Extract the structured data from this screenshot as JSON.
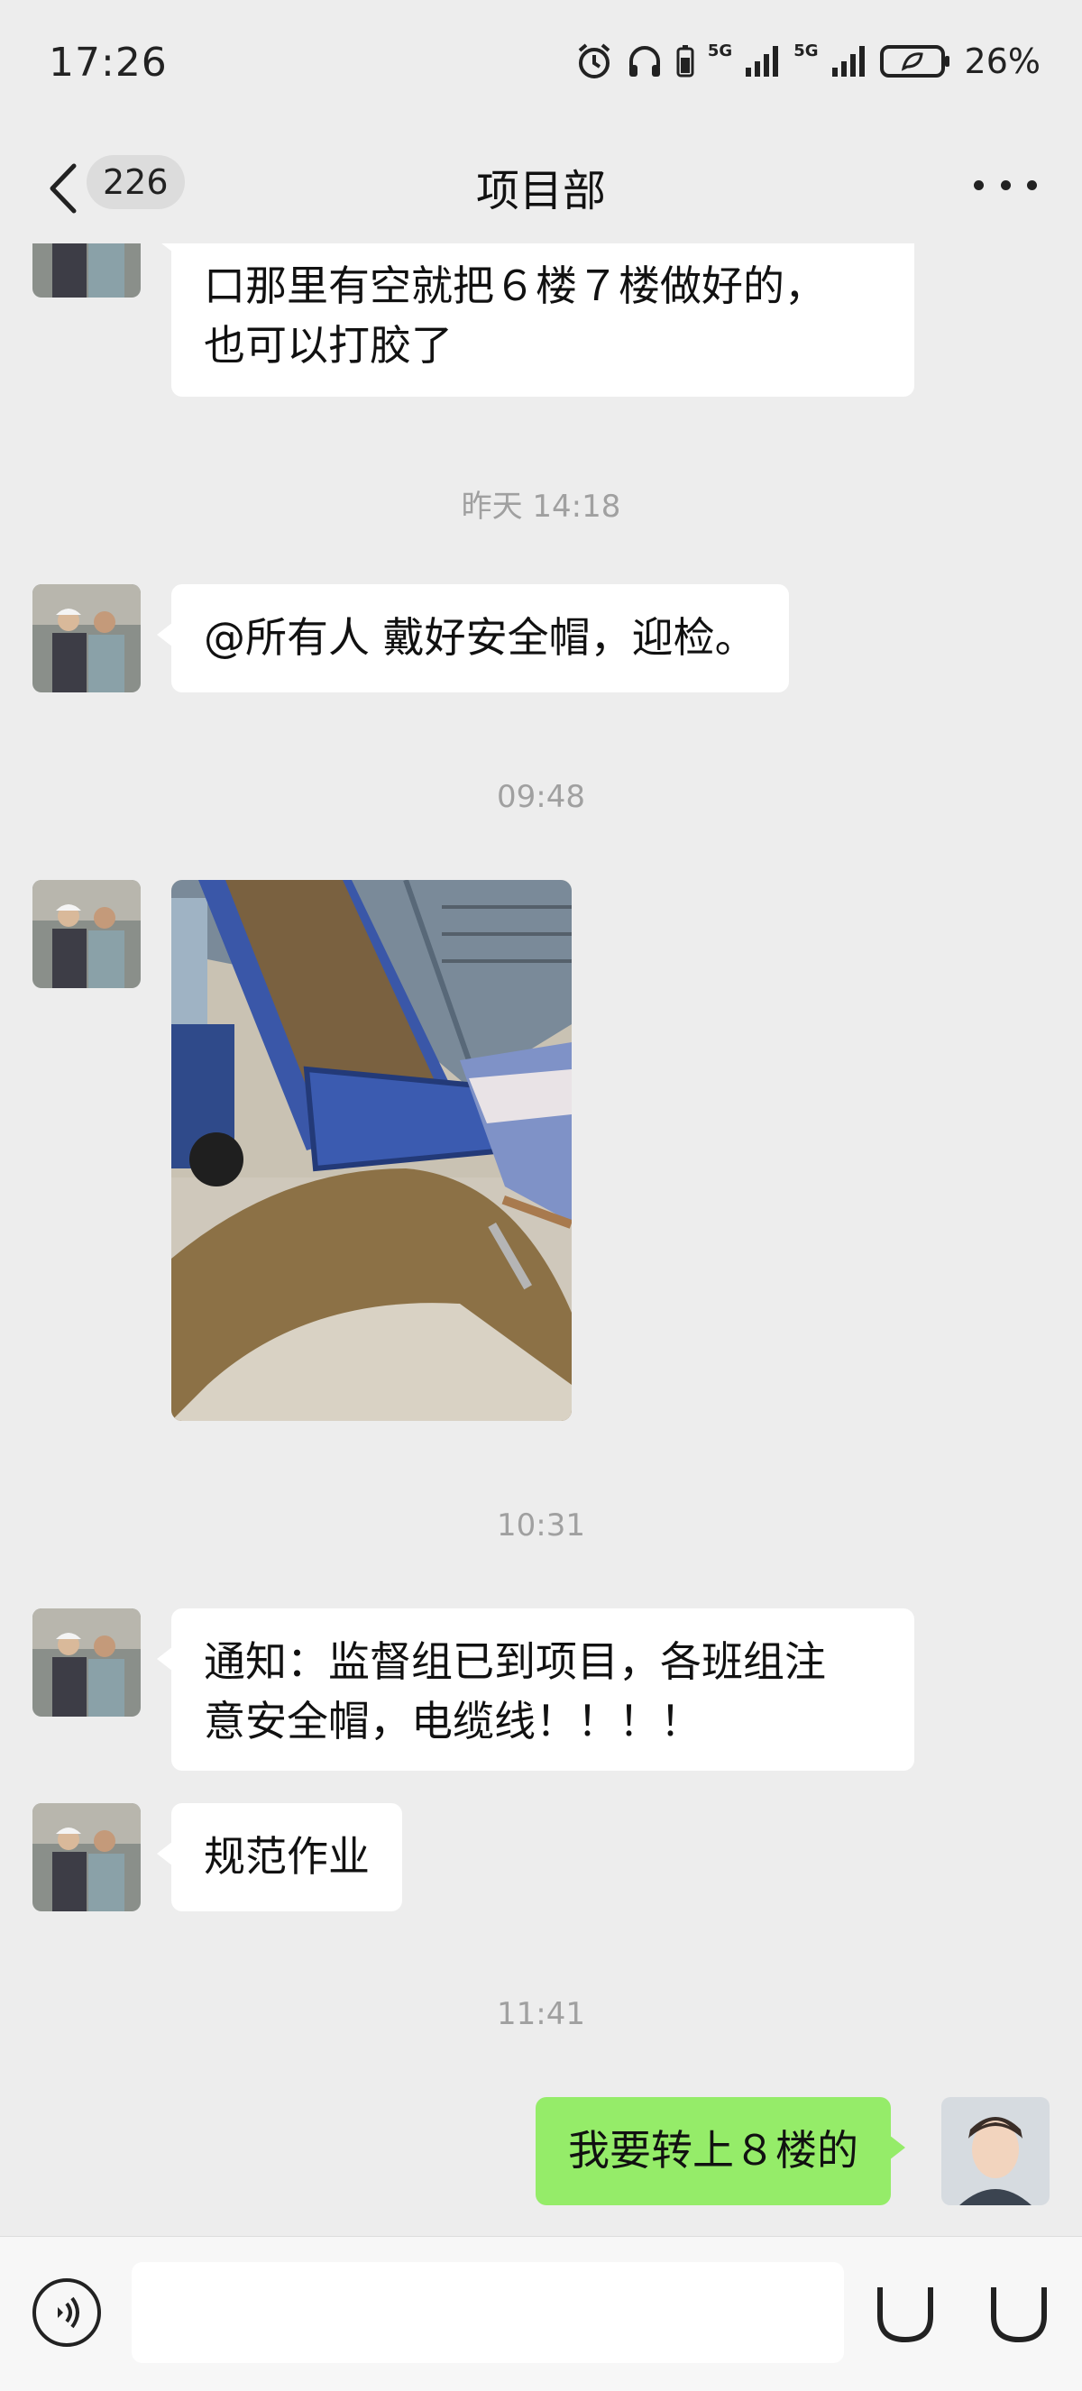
{
  "status": {
    "time": "17:26",
    "signal_1": "5G",
    "signal_2": "5G",
    "battery": "26%"
  },
  "header": {
    "unread_count": "226",
    "title": "项目部"
  },
  "messages": {
    "m1_line1": "口那里有空就把６楼７楼做好的，",
    "m1_line2": "也可以打胶了",
    "ts1": "昨天 14:18",
    "m2": "@所有人  戴好安全帽，迎检。",
    "ts2": "09:48",
    "ts3": "10:31",
    "m4_line1": "通知：监督组已到项目，各班组注",
    "m4_line2": "意安全帽，电缆线！！！！",
    "m5": "规范作业",
    "ts4": "11:41",
    "m6": "我要转上８楼的"
  },
  "colors": {
    "bg": "#ededed",
    "bubble_in": "#ffffff",
    "bubble_out": "#95ec69",
    "timestamp": "#a0a0a0"
  },
  "icons": [
    "chevron-left-icon",
    "more-icon",
    "voice-icon",
    "emoji-icon",
    "plus-icon",
    "alarm-icon",
    "headphones-icon",
    "signal-icon",
    "battery-icon"
  ]
}
